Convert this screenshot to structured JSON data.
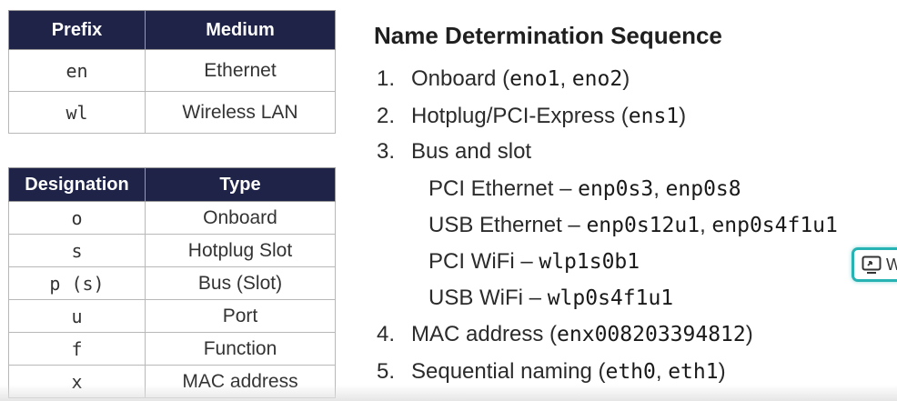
{
  "prefix_table": {
    "headers": [
      "Prefix",
      "Medium"
    ],
    "rows": [
      [
        "en",
        "Ethernet"
      ],
      [
        "wl",
        "Wireless LAN"
      ]
    ]
  },
  "designation_table": {
    "headers": [
      "Designation",
      "Type"
    ],
    "rows": [
      [
        "o",
        "Onboard"
      ],
      [
        "s",
        "Hotplug Slot"
      ],
      [
        "p (s)",
        "Bus (Slot)"
      ],
      [
        "u",
        "Port"
      ],
      [
        "f",
        "Function"
      ],
      [
        "x",
        "MAC address"
      ]
    ]
  },
  "sequence": {
    "title": "Name Determination Sequence",
    "items": [
      {
        "num": "1.",
        "text": "Onboard (",
        "codes": [
          "eno1",
          ", ",
          "eno2"
        ],
        "suffix": ")"
      },
      {
        "num": "2.",
        "text": "Hotplug/PCI-Express (",
        "codes": [
          "ens1"
        ],
        "suffix": ")"
      },
      {
        "num": "3.",
        "text": "Bus and slot"
      },
      {
        "sub": true,
        "text": "PCI Ethernet – ",
        "codes": [
          "enp0s3",
          ", ",
          "enp0s8"
        ]
      },
      {
        "sub": true,
        "text": "USB Ethernet – ",
        "codes": [
          "enp0s12u1",
          ", ",
          "enp0s4f1u1"
        ]
      },
      {
        "sub": true,
        "text": "PCI WiFi – ",
        "codes": [
          "wlp1s0b1"
        ]
      },
      {
        "sub": true,
        "text": "USB WiFi – ",
        "codes": [
          "wlp0s4f1u1"
        ]
      },
      {
        "num": "4.",
        "text": "MAC address (",
        "codes": [
          "enx008203394812"
        ],
        "suffix": ")"
      },
      {
        "num": "5.",
        "text": "Sequential naming (",
        "codes": [
          "eth0",
          ", ",
          "eth1"
        ],
        "suffix": ")"
      }
    ]
  },
  "overlay_button": {
    "label": "W",
    "icon": "screen-share-icon",
    "border_color": "#27b3b3"
  }
}
